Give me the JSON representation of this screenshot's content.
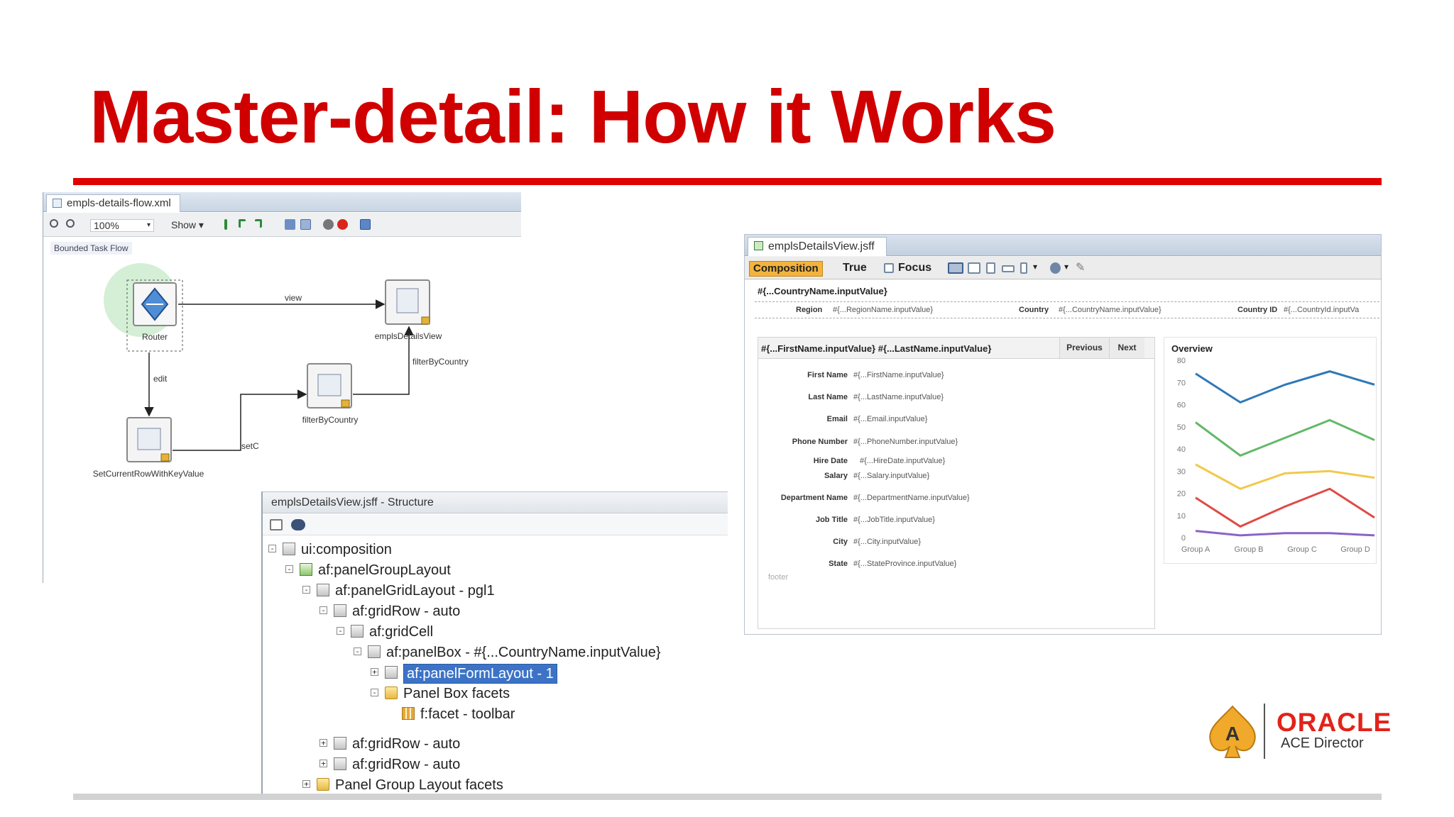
{
  "slide": {
    "title": "Master-detail: How it Works"
  },
  "flow_editor": {
    "tab_title": "empls-details-flow.xml",
    "zoom": "100%",
    "show_menu": "Show",
    "canvas_label": "Bounded Task Flow",
    "nodes": {
      "router": "Router",
      "view": "emplsDetailsView",
      "filter": "filterByCountry",
      "setrow": "SetCurrentRowWithKeyValue"
    },
    "edges": {
      "view": "view",
      "edit": "edit",
      "filter": "filterByCountry",
      "setcurrent": "setC"
    },
    "colors": {
      "router_halo": "#cdeccf",
      "node_border": "#8a8a8a"
    }
  },
  "jsf_editor": {
    "tab_title": "emplsDetailsView.jsff",
    "composition_tab": "Composition",
    "toolbar_true": "True",
    "toolbar_focus": "Focus",
    "region_header": "#{...CountryName.inputValue}",
    "region": [
      {
        "label": "Region",
        "value": "#{...RegionName.inputValue}"
      },
      {
        "label": "Country",
        "value": "#{...CountryName.inputValue}"
      },
      {
        "label": "Country ID",
        "value": "#{...CountryId.inputVa"
      }
    ],
    "detail": {
      "title": "#{...FirstName.inputValue} #{...LastName.inputValue}",
      "previous": "Previous",
      "next": "Next",
      "fields": [
        {
          "label": "First Name",
          "value": "#{...FirstName.inputValue}"
        },
        {
          "label": "Last Name",
          "value": "#{...LastName.inputValue}"
        },
        {
          "label": "Email",
          "value": "#{...Email.inputValue}"
        },
        {
          "label": "Phone Number",
          "value": "#{...PhoneNumber.inputValue}"
        },
        {
          "label": "Hire Date",
          "value": "#{...HireDate.inputValue}"
        },
        {
          "label": "Salary",
          "value": "#{...Salary.inputValue}"
        },
        {
          "label": "Department Name",
          "value": "#{...DepartmentName.inputValue}"
        },
        {
          "label": "Job Title",
          "value": "#{...JobTitle.inputValue}"
        },
        {
          "label": "City",
          "value": "#{...City.inputValue}"
        },
        {
          "label": "State",
          "value": "#{...StateProvince.inputValue}"
        }
      ],
      "footer": "footer"
    },
    "overview_title": "Overview"
  },
  "chart_data": {
    "type": "line",
    "title": "Overview",
    "categories": [
      "Group A",
      "Group B",
      "Group C",
      "Group D"
    ],
    "ylim": [
      0,
      80
    ],
    "yticks": [
      0,
      10,
      20,
      30,
      40,
      50,
      60,
      70,
      80
    ],
    "grid": false,
    "series": [
      {
        "values": [
          74,
          61,
          69,
          75,
          69
        ],
        "color": "#2f78b8"
      },
      {
        "values": [
          52,
          37,
          45,
          53,
          44
        ],
        "color": "#63b868"
      },
      {
        "values": [
          33,
          22,
          29,
          30,
          27
        ],
        "color": "#f1c94b"
      },
      {
        "values": [
          18,
          5,
          14,
          22,
          9
        ],
        "color": "#e04a45"
      },
      {
        "values": [
          3,
          1,
          2,
          2,
          1
        ],
        "color": "#8a63c9"
      }
    ]
  },
  "structure": {
    "title": "emplsDetailsView.jsff - Structure",
    "rows": [
      {
        "text": "ui:composition",
        "exp": "-",
        "icon": "page"
      },
      {
        "text": "af:panelGroupLayout",
        "exp": "-",
        "icon": "green"
      },
      {
        "text": "af:panelGridLayout - pgl1",
        "exp": "-",
        "icon": "grid"
      },
      {
        "text": "af:gridRow - auto",
        "exp": "-",
        "icon": "grid"
      },
      {
        "text": "af:gridCell",
        "exp": "-",
        "icon": "grid"
      },
      {
        "text": "af:panelBox - #{...CountryName.inputValue}",
        "exp": "-",
        "icon": "grid"
      },
      {
        "text": "af:panelFormLayout - 1",
        "exp": "+",
        "icon": "grid"
      },
      {
        "text": "Panel Box facets",
        "exp": "-",
        "icon": "folder"
      },
      {
        "text": "f:facet - toolbar",
        "exp": "",
        "icon": "facet"
      },
      {
        "text": "af:gridRow - auto",
        "exp": "+",
        "icon": "grid"
      },
      {
        "text": "af:gridRow - auto",
        "exp": "+",
        "icon": "grid"
      },
      {
        "text": "Panel Group Layout facets",
        "exp": "+",
        "icon": "folder"
      }
    ]
  },
  "logo": {
    "brand": "ORACLE",
    "badge": "ACE Director",
    "badge_letter": "A",
    "color": "#e2231a"
  }
}
